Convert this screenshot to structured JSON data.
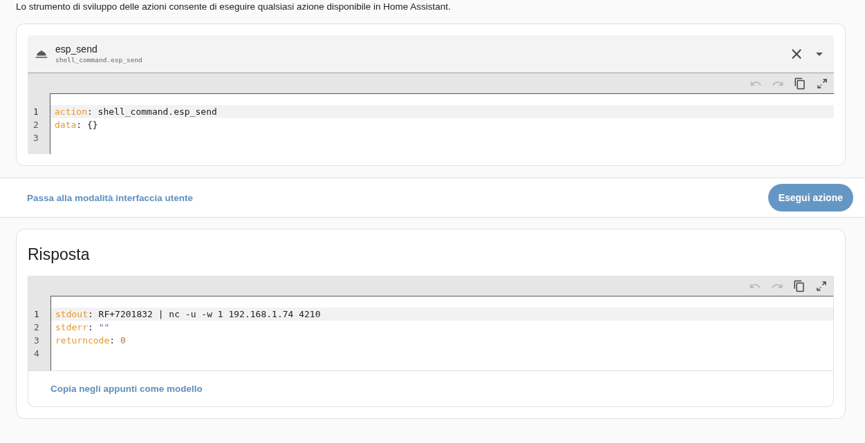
{
  "intro": "Lo strumento di sviluppo delle azioni consente di eseguire qualsiasi azione disponibile in Home Assistant.",
  "action": {
    "name": "esp_send",
    "id": "shell_command.esp_send",
    "clear_label": "×"
  },
  "editor": {
    "toolbar": [
      {
        "kind": "undo",
        "disabled": true
      },
      {
        "kind": "redo",
        "disabled": true
      },
      {
        "kind": "copy",
        "disabled": false
      },
      {
        "kind": "fullscreen",
        "disabled": false
      }
    ],
    "lines": [
      {
        "number": "1",
        "active": true,
        "tokens": [
          {
            "kind": "key",
            "text": "action"
          },
          {
            "kind": "plain",
            "text": ": shell_command.esp_send"
          }
        ]
      },
      {
        "number": "2",
        "active": false,
        "tokens": [
          {
            "kind": "key",
            "text": "data"
          },
          {
            "kind": "plain",
            "text": ": {}"
          }
        ]
      },
      {
        "number": "3",
        "active": false
      }
    ]
  },
  "actions_bar": {
    "toggle_link": "Passa alla modalità interfaccia utente",
    "run_button": "Esegui azione"
  },
  "response": {
    "title": "Risposta",
    "toolbar": [
      {
        "kind": "undo",
        "disabled": true
      },
      {
        "kind": "redo",
        "disabled": true
      },
      {
        "kind": "copy",
        "disabled": false
      },
      {
        "kind": "fullscreen",
        "disabled": false
      }
    ],
    "lines": [
      {
        "number": "1",
        "active": true,
        "tokens": [
          {
            "kind": "key",
            "text": "stdout"
          },
          {
            "kind": "plain",
            "text": ": RF+7201832 | nc -u -w 1 192.168.1.74 4210"
          }
        ]
      },
      {
        "number": "2",
        "active": false,
        "tokens": [
          {
            "kind": "key",
            "text": "stderr"
          },
          {
            "kind": "plain",
            "text": ": "
          },
          {
            "kind": "string",
            "text": "\"\""
          }
        ]
      },
      {
        "number": "3",
        "active": false,
        "tokens": [
          {
            "kind": "key",
            "text": "returncode"
          },
          {
            "kind": "plain",
            "text": ": "
          },
          {
            "kind": "number",
            "text": "0"
          }
        ]
      },
      {
        "number": "4",
        "active": false
      }
    ],
    "copy_link": "Copia negli appunti come modello"
  }
}
